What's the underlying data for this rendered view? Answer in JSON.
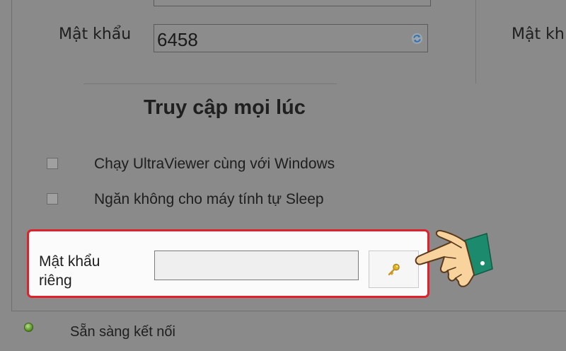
{
  "password": {
    "label": "Mật khẩu",
    "value": "6458",
    "refresh_icon": "refresh-icon"
  },
  "right_panel": {
    "password_label_partial": "Mật kh"
  },
  "always_access": {
    "title": "Truy cập mọi lúc",
    "options": [
      {
        "label": "Chạy UltraViewer cùng với Windows",
        "checked": false
      },
      {
        "label": "Ngăn không cho máy tính tự Sleep",
        "checked": false
      }
    ]
  },
  "private_password": {
    "label_line1": "Mật khẩu",
    "label_line2": "riêng",
    "value": "",
    "key_icon": "key-icon",
    "highlight_color": "#e0202a"
  },
  "status": {
    "text": "Sẵn sàng kết nối",
    "color": "#5a9a22"
  },
  "pointer_icon": "pointing-hand-icon"
}
